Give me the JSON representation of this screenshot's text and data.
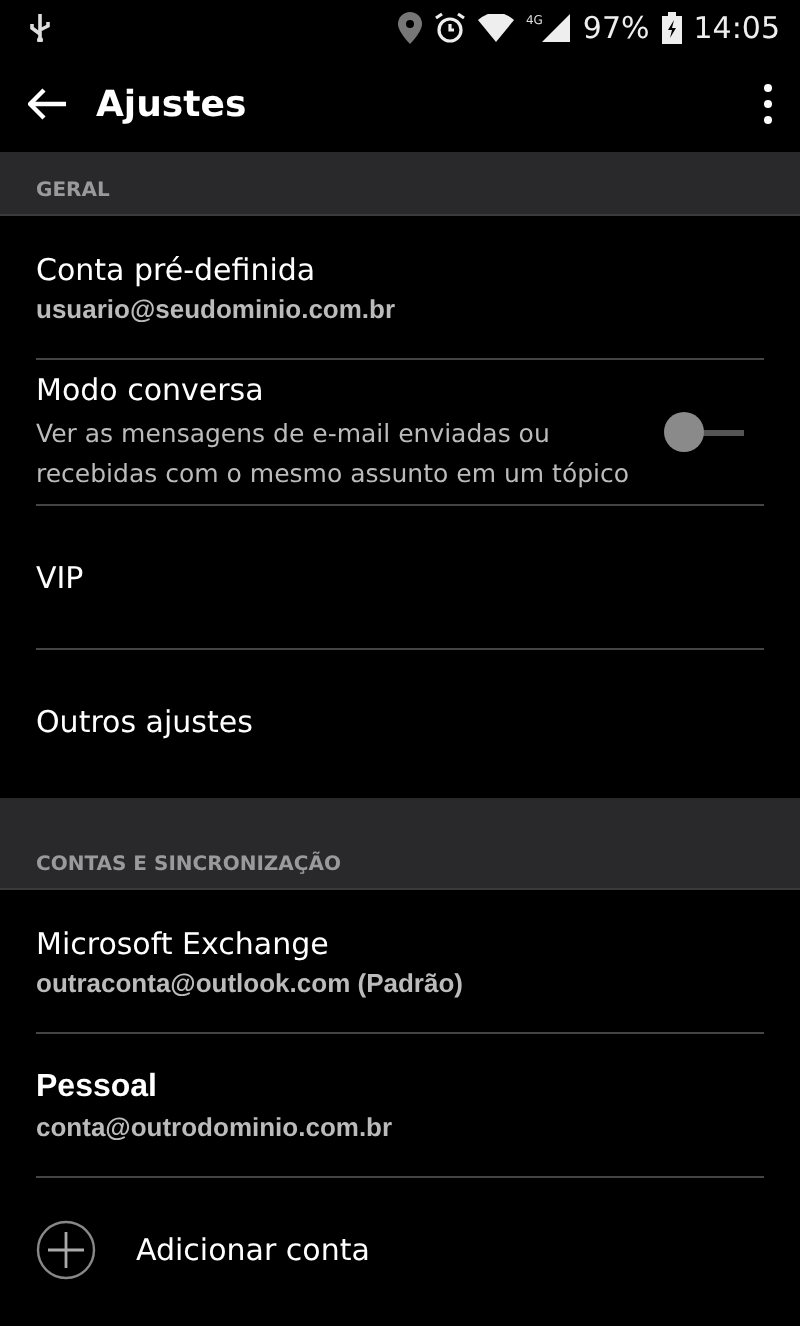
{
  "status_bar": {
    "battery": "97%",
    "time": "14:05",
    "network": "4G"
  },
  "app_bar": {
    "title": "Ajustes"
  },
  "sections": [
    {
      "header": "GERAL",
      "items": [
        {
          "kind": "text",
          "title": "Conta pré-definida",
          "subtitle": "usuario@seudominio.com.br"
        },
        {
          "kind": "toggle",
          "title": "Modo conversa",
          "subtitle": "Ver as mensagens de e-mail enviadas ou recebidas com o mesmo assunto em um tópico",
          "on": false
        },
        {
          "kind": "text",
          "title": "VIP"
        },
        {
          "kind": "text",
          "title": "Outros ajustes"
        }
      ]
    },
    {
      "header": "CONTAS E SINCRONIZAÇÃO",
      "items": [
        {
          "kind": "text",
          "title": "Microsoft Exchange",
          "subtitle": "outraconta@outlook.com (Padrão)"
        },
        {
          "kind": "text",
          "title": "Pessoal",
          "subtitle": "conta@outrodominio.com.br"
        },
        {
          "kind": "add",
          "title": "Adicionar conta"
        }
      ]
    }
  ]
}
